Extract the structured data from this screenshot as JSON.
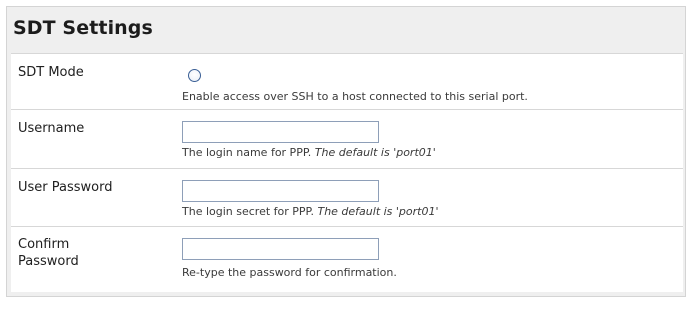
{
  "panel": {
    "title": "SDT Settings"
  },
  "rows": [
    {
      "label": "SDT Mode",
      "help": "Enable access over SSH to a host connected to this serial port.",
      "default_note": "",
      "control": "radio"
    },
    {
      "label": "Username",
      "help": "The login name for PPP. ",
      "default_note": "The default is 'port01'",
      "value": "",
      "control": "text"
    },
    {
      "label": "User Password",
      "help": "The login secret for PPP. ",
      "default_note": "The default is 'port01'",
      "value": "",
      "control": "password"
    },
    {
      "label_line1": "Confirm",
      "label_line2": "Password",
      "help": "Re-type the password for confirmation.",
      "default_note": "",
      "value": "",
      "control": "password"
    }
  ],
  "colors": {
    "panel_bg": "#efefef",
    "row_bg": "#ffffff",
    "input_border": "#8e9fb8",
    "radio_border": "#3a5f95"
  }
}
